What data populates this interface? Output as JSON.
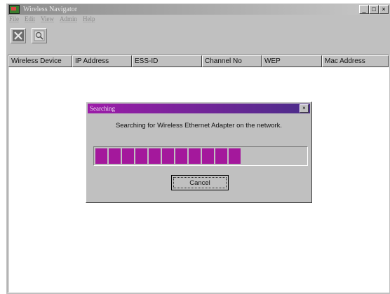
{
  "window": {
    "title": "Wireless Navigator"
  },
  "controls": {
    "minimize": "_",
    "maximize": "□",
    "close": "×"
  },
  "menu": [
    "File",
    "Edit",
    "View",
    "Admin",
    "Help"
  ],
  "toolbar": {
    "buttons": [
      {
        "icon": "close-x-icon"
      },
      {
        "icon": "search-icon"
      }
    ]
  },
  "table": {
    "columns": [
      "Wireless Device",
      "IP Address",
      "ESS-ID",
      "Channel No",
      "WEP",
      "Mac Address"
    ]
  },
  "dialog": {
    "title": "Searching",
    "close": "×",
    "message": "Searching for Wireless Ethernet Adapter on the network.",
    "progress": 0.75,
    "cancel_label": "Cancel"
  },
  "colors": {
    "progress": "#a4189c",
    "dialog_title": "#9c1ca8"
  }
}
